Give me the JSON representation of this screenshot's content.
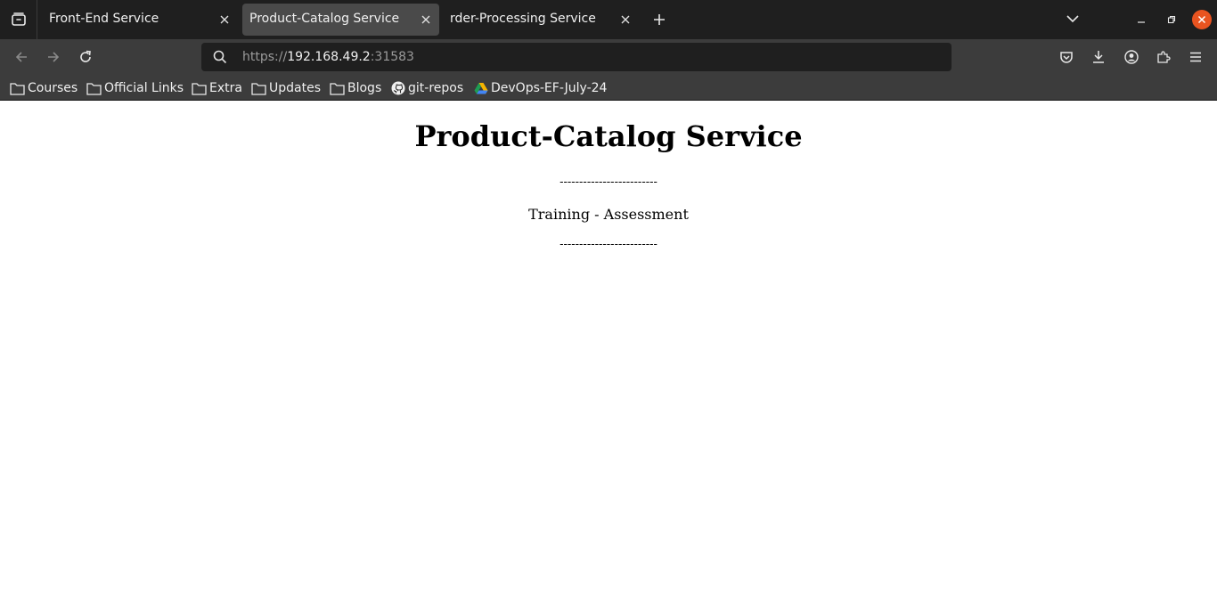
{
  "browser": {
    "tabs": [
      {
        "label": "Front-End Service",
        "active": false
      },
      {
        "label": "Product-Catalog Service",
        "active": true
      },
      {
        "label": "rder-Processing Service",
        "active": false
      }
    ],
    "url": {
      "scheme": "https://",
      "host": "192.168.49.2",
      "port": ":31583"
    },
    "bookmarks": [
      {
        "label": "Courses",
        "icon": "folder-icon"
      },
      {
        "label": "Official Links",
        "icon": "folder-icon"
      },
      {
        "label": "Extra",
        "icon": "folder-icon"
      },
      {
        "label": "Updates",
        "icon": "folder-icon"
      },
      {
        "label": "Blogs",
        "icon": "folder-icon"
      },
      {
        "label": "git-repos",
        "icon": "github-icon"
      },
      {
        "label": "DevOps-EF-July-24",
        "icon": "google-drive-icon"
      }
    ],
    "colors": {
      "tab_strip": "#1f1f1f",
      "toolbar": "#3c3c3c",
      "active_tab": "#4a4a4a",
      "close_window": "#e95420"
    }
  },
  "page": {
    "heading": "Product-Catalog Service",
    "divider_top": "-------------------------",
    "subtitle": "Training - Assessment",
    "divider_bottom": "-------------------------"
  }
}
